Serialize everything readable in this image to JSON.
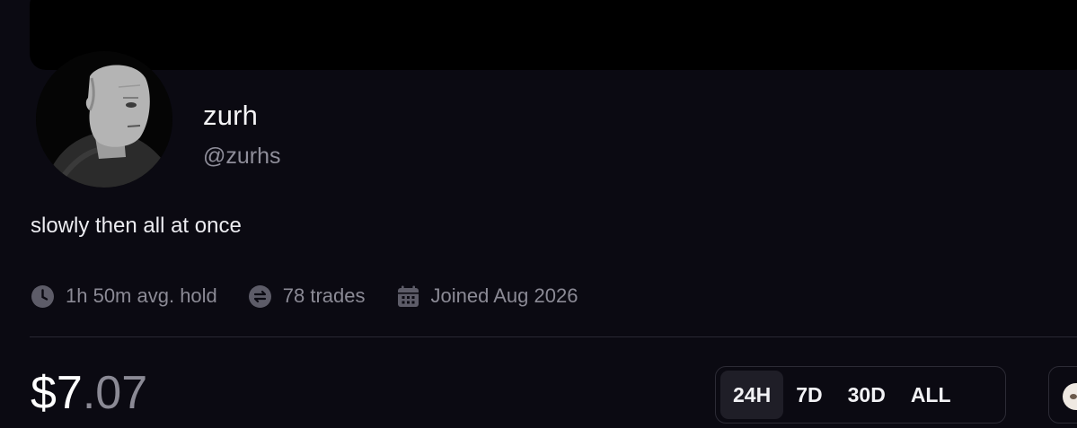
{
  "profile": {
    "display_name": "zurh",
    "handle": "@zurhs",
    "bio": "slowly then all at once",
    "avatar": "wojak-avatar"
  },
  "stats": [
    {
      "icon": "clock-icon",
      "text": "1h 50m avg. hold"
    },
    {
      "icon": "swap-icon",
      "text": "78 trades"
    },
    {
      "icon": "calendar-icon",
      "text": "Joined Aug 2026"
    }
  ],
  "balance": {
    "whole": "$7",
    "cents": ".07"
  },
  "range_tabs": [
    {
      "label": "24H",
      "active": true
    },
    {
      "label": "7D",
      "active": false
    },
    {
      "label": "30D",
      "active": false
    },
    {
      "label": "ALL",
      "active": false
    }
  ],
  "colors": {
    "background": "#0b0a12",
    "banner": "#000000",
    "muted_text": "#8b8a95",
    "border": "#2c2b35",
    "active_tab": "#1f1e27"
  }
}
